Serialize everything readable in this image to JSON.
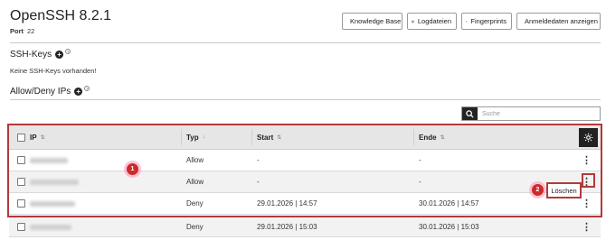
{
  "header": {
    "title": "OpenSSH 8.2.1",
    "port_label": "Port",
    "port_value": "22"
  },
  "toolbar": {
    "knowledge_base": "Knowledge Base",
    "logfiles": "Logdateien",
    "fingerprints": "Fingerprints",
    "show_credentials": "Anmeldedaten anzeigen"
  },
  "ssh_keys": {
    "title": "SSH-Keys",
    "empty_text": "Keine SSH-Keys vorhanden!"
  },
  "allow_deny": {
    "title": "Allow/Deny IPs"
  },
  "search": {
    "placeholder": "Suche"
  },
  "table": {
    "columns": {
      "ip": "IP",
      "typ": "Typ",
      "start": "Start",
      "ende": "Ende"
    },
    "rows": [
      {
        "ip": "",
        "typ": "Allow",
        "start": "-",
        "ende": "-"
      },
      {
        "ip": "",
        "typ": "Allow",
        "start": "-",
        "ende": "-"
      },
      {
        "ip": "",
        "typ": "Deny",
        "start": "29.01.2026 | 14:57",
        "ende": "30.01.2026 | 14:57"
      },
      {
        "ip": "",
        "typ": "Deny",
        "start": "29.01.2026 | 15:03",
        "ende": "30.01.2026 | 15:03"
      }
    ]
  },
  "annotations": {
    "step1": "1",
    "step2": "2"
  },
  "context_menu": {
    "delete": "Löschen"
  },
  "colors": {
    "highlight_red": "#b33a3a",
    "badge_red": "#cc2b2b",
    "header_gray": "#e6e6e6",
    "dark_button": "#222222"
  }
}
